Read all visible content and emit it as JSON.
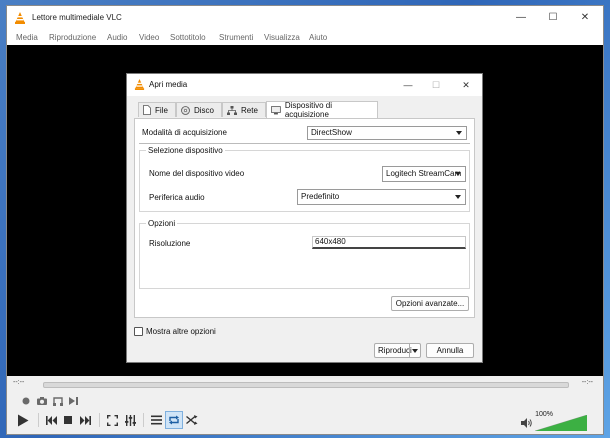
{
  "window": {
    "title": "Lettore multimediale VLC",
    "controls": {
      "minimize": "—",
      "maximize": "☐",
      "close": "✕"
    }
  },
  "menu": [
    "Media",
    "Riproduzione",
    "Audio",
    "Video",
    "Sottotitolo",
    "Strumenti",
    "Visualizza",
    "Aiuto"
  ],
  "player": {
    "time_elapsed": "--:--",
    "time_remaining": "--:--",
    "volume": "100%",
    "volume_level": 1.0
  },
  "dialog": {
    "title": "Apri media",
    "controls": {
      "minimize": "—",
      "maximize": "☐",
      "close": "✕"
    },
    "tabs": [
      "File",
      "Disco",
      "Rete",
      "Dispositivo di acquisizione"
    ],
    "active_tab": "Dispositivo di acquisizione",
    "capture_mode": {
      "label": "Modalità di acquisizione",
      "value": "DirectShow"
    },
    "device_group": {
      "title": "Selezione dispositivo",
      "video_label": "Nome del dispositivo video",
      "video_value": "Logitech StreamCam",
      "audio_label": "Periferica audio",
      "audio_value": "Predefinito"
    },
    "options_group": {
      "title": "Opzioni",
      "resolution_label": "Risoluzione",
      "resolution_value": "640x480",
      "advanced_button": "Opzioni avanzate..."
    },
    "show_more": {
      "label": "Mostra altre opzioni",
      "checked": false
    },
    "play_button": "Riproduci",
    "cancel_button": "Annulla"
  },
  "colors": {
    "accent_green": "#3cb043",
    "vlc_orange": "#f28c00"
  }
}
